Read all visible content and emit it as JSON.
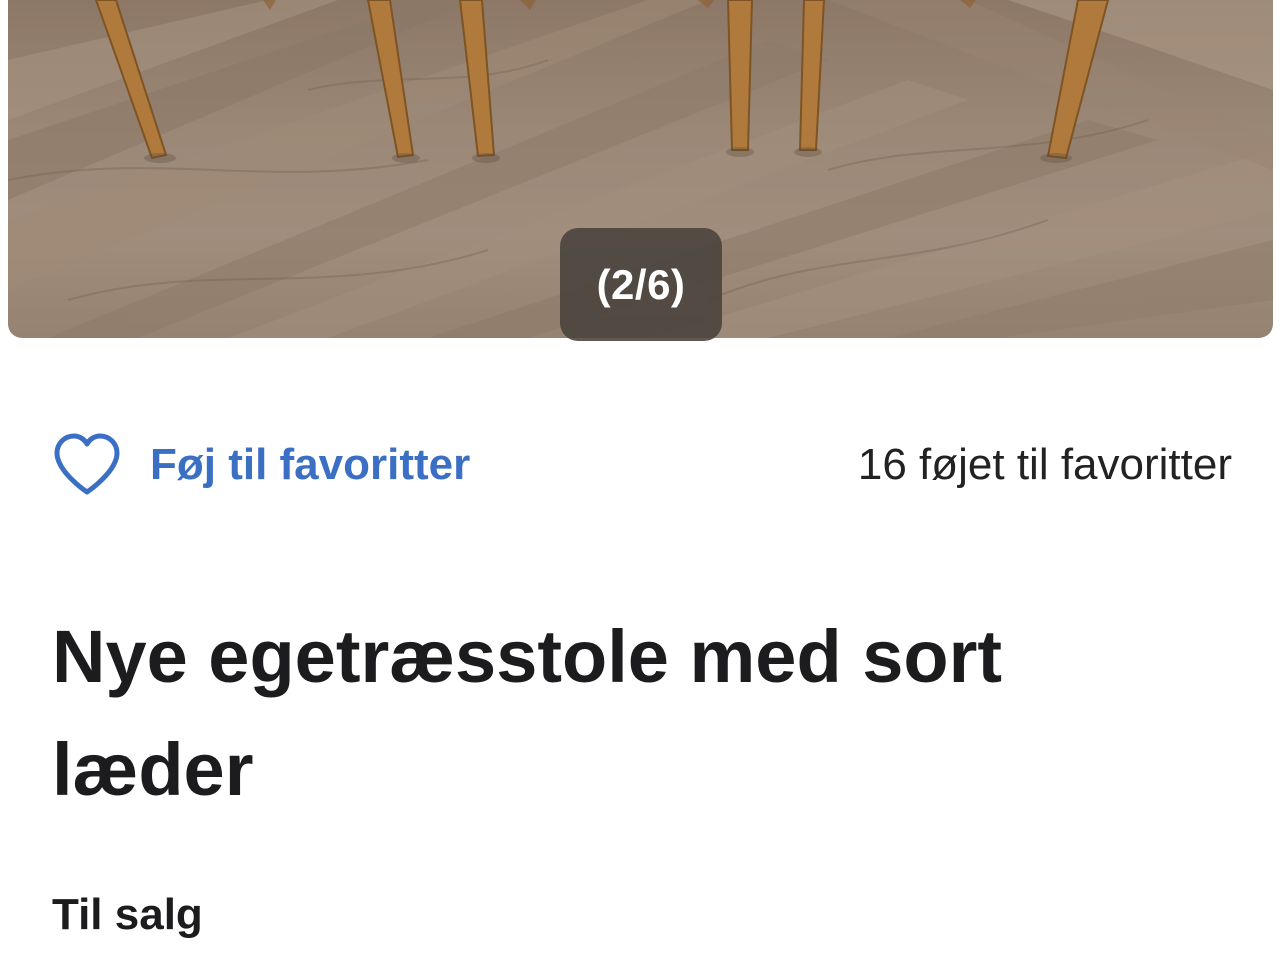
{
  "gallery": {
    "counter": "(2/6)"
  },
  "favorites": {
    "button_label": "Føj til favoritter",
    "count_text": "16 føjet til favoritter",
    "accent_color": "#3b6fc4",
    "icon": "heart-outline-icon"
  },
  "listing": {
    "title": "Nye egetræsstole med sort læder",
    "status": "Til salg"
  }
}
